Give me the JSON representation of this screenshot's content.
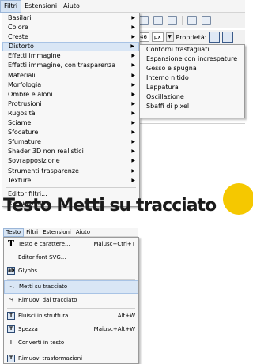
{
  "menubar": {
    "items": [
      {
        "label": "Filtri",
        "active": true
      },
      {
        "label": "Estensioni",
        "active": false
      },
      {
        "label": "Aiuto",
        "active": false
      }
    ]
  },
  "toolbar": {
    "unit_value": "46",
    "unit": "px",
    "properties_label": "Proprietà:"
  },
  "filters_menu": {
    "items": [
      {
        "label": "Basilari",
        "submenu": true
      },
      {
        "label": "Colore",
        "submenu": true
      },
      {
        "label": "Creste",
        "submenu": true
      },
      {
        "label": "Distorto",
        "submenu": true,
        "highlight": true
      },
      {
        "label": "Effetti immagine",
        "submenu": true
      },
      {
        "label": "Effetti immagine, con trasparenza",
        "submenu": true
      },
      {
        "label": "Materiali",
        "submenu": true
      },
      {
        "label": "Morfologia",
        "submenu": true
      },
      {
        "label": "Ombre e aloni",
        "submenu": true
      },
      {
        "label": "Protrusioni",
        "submenu": true
      },
      {
        "label": "Rugosità",
        "submenu": true
      },
      {
        "label": "Sciame",
        "submenu": true
      },
      {
        "label": "Sfocature",
        "submenu": true
      },
      {
        "label": "Sfumature",
        "submenu": true
      },
      {
        "label": "Shader 3D non realistici",
        "submenu": true
      },
      {
        "label": "Sovrapposizione",
        "submenu": true
      },
      {
        "label": "Strumenti trasparenze",
        "submenu": true
      },
      {
        "label": "Texture",
        "submenu": true
      }
    ],
    "editor": "Editor filtri...",
    "remove": "Rimuovi filtri"
  },
  "distort_submenu": {
    "items": [
      "Contorni frastagliati",
      "Espansione con increspature",
      "Gesso e spugna",
      "Interno nitido",
      "Lappatura",
      "Oscillazione",
      "Sbaffi di pixel"
    ]
  },
  "overlay": {
    "text": "Testo Metti su tracciato"
  },
  "menubar2": {
    "items": [
      {
        "label": "Testo",
        "active": true
      },
      {
        "label": "Filtri",
        "active": false
      },
      {
        "label": "Estensioni",
        "active": false
      },
      {
        "label": "Aiuto",
        "active": false
      }
    ]
  },
  "text_menu": {
    "items": [
      {
        "label": "Testo e carattere...",
        "shortcut": "Maiusc+Ctrl+T",
        "icon": "text-T-icon"
      },
      {
        "label": "Editor font SVG...",
        "shortcut": "",
        "icon": ""
      },
      {
        "label": "Glyphs...",
        "shortcut": "",
        "icon": "glyphs-icon"
      },
      {
        "label": "Metti su tracciato",
        "shortcut": "",
        "icon": "put-on-path-icon",
        "highlight": true
      },
      {
        "label": "Rimuovi dal tracciato",
        "shortcut": "",
        "icon": "remove-from-path-icon"
      },
      {
        "label": "Fluisci in struttura",
        "shortcut": "Alt+W",
        "icon": "flow-into-frame-icon"
      },
      {
        "label": "Spezza",
        "shortcut": "Maiusc+Alt+W",
        "icon": "unflow-icon"
      },
      {
        "label": "Converti in testo",
        "shortcut": "",
        "icon": "convert-to-text-icon"
      },
      {
        "label": "Rimuovi trasformazioni",
        "shortcut": "",
        "icon": "remove-transforms-icon"
      }
    ]
  },
  "colors": {
    "highlight": "#d9e6f5",
    "menu_bg": "#f7f7f7",
    "accent_yellow": "#f5c800"
  }
}
